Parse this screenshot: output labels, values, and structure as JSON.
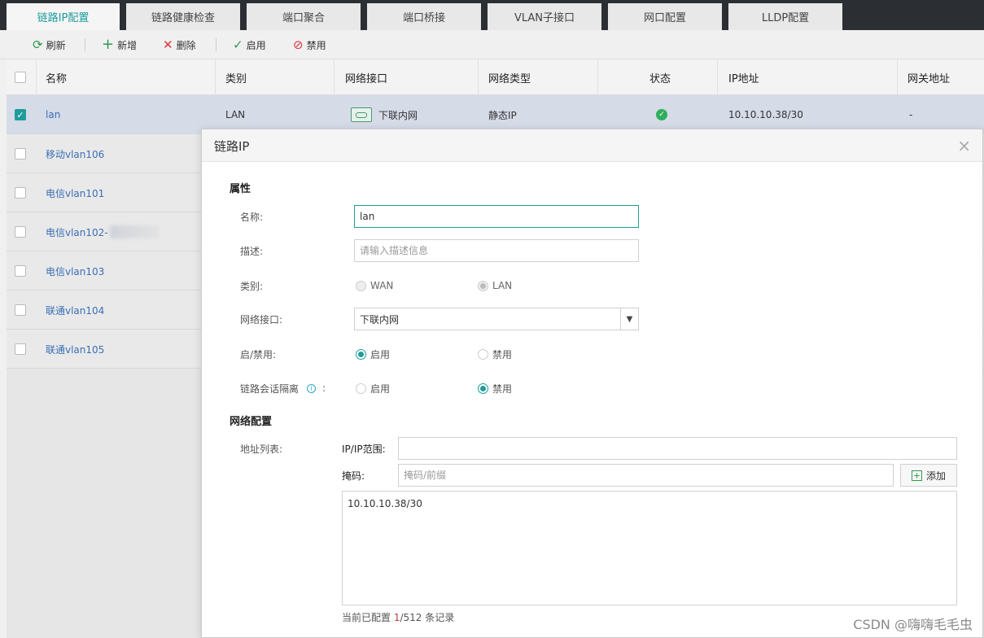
{
  "tabs": [
    "链路IP配置",
    "链路健康检查",
    "端口聚合",
    "端口桥接",
    "VLAN子接口",
    "网口配置",
    "LLDP配置"
  ],
  "toolbar": {
    "refresh": "刷新",
    "add": "新增",
    "delete": "删除",
    "enable": "启用",
    "disable": "禁用"
  },
  "table": {
    "columns": [
      "名称",
      "类别",
      "网络接口",
      "网络类型",
      "状态",
      "IP地址",
      "网关地址"
    ],
    "rows": [
      {
        "name": "lan",
        "category": "LAN",
        "interface": "下联内网",
        "net_type": "静态IP",
        "ip": "10.10.10.38/30",
        "gateway": "-"
      },
      {
        "name": "移动vlan106"
      },
      {
        "name": "电信vlan101"
      },
      {
        "name": "电信vlan102-"
      },
      {
        "name": "电信vlan103"
      },
      {
        "name": "联通vlan104"
      },
      {
        "name": "联通vlan105"
      }
    ]
  },
  "dialog": {
    "title": "链路IP",
    "close": "×",
    "section_props": "属性",
    "name_label": "名称:",
    "name_value": "lan",
    "desc_label": "描述:",
    "desc_placeholder": "请输入描述信息",
    "category_label": "类别:",
    "category_options": [
      "WAN",
      "LAN"
    ],
    "category_selected": "LAN",
    "iface_label": "网络接口:",
    "iface_value": "下联内网",
    "toggle_label": "启/禁用:",
    "toggle_options": [
      "启用",
      "禁用"
    ],
    "toggle_selected": "启用",
    "isolation_label": "链路会话隔离",
    "isolation_colon": ":",
    "isolation_options": [
      "启用",
      "禁用"
    ],
    "isolation_selected": "禁用",
    "section_net": "网络配置",
    "addr_label": "地址列表:",
    "ip_range_label": "IP/IP范围:",
    "mask_label": "掩码:",
    "mask_placeholder": "掩码/前缀",
    "add_button": "添加",
    "addr_list": [
      "10.10.10.38/30"
    ],
    "count_prefix": "当前已配置 ",
    "count_current": "1",
    "count_suffix": "/512 条记录"
  },
  "watermark": "CSDN @嗨嗨毛毛虫"
}
